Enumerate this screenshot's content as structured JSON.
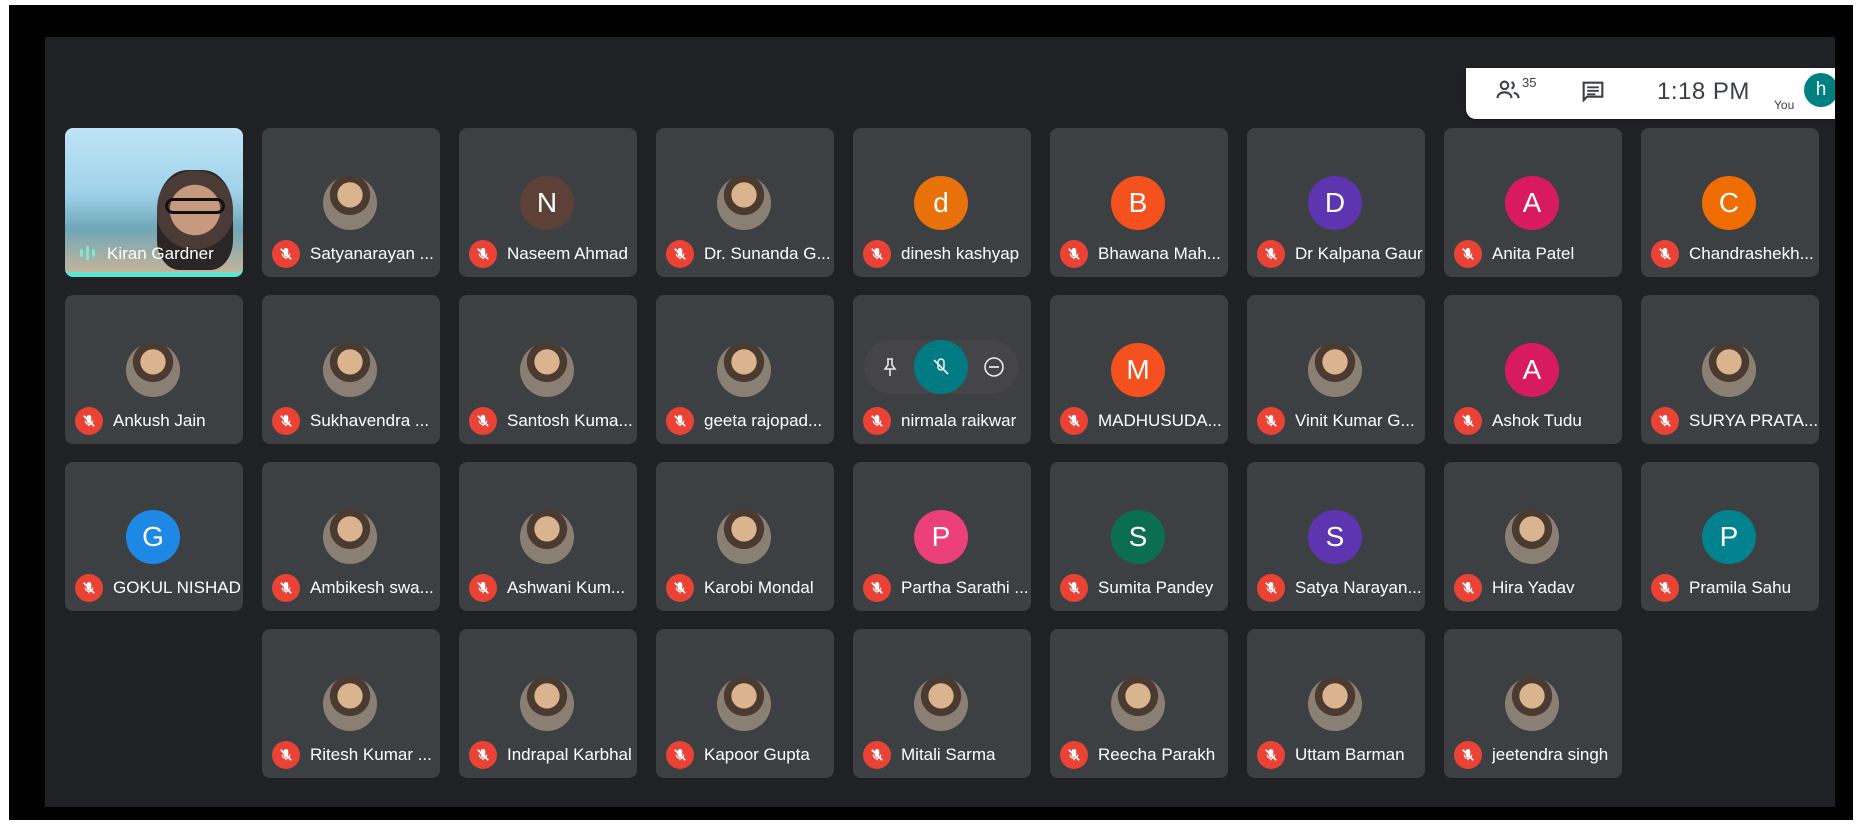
{
  "topbar": {
    "participant_count": "35",
    "time": "1:18 PM",
    "you_label": "You",
    "self_initial": "h",
    "self_color": "#008080"
  },
  "icons": {
    "people": "people-icon",
    "chat": "chat-icon",
    "mic_off": "mic-off-icon",
    "pin": "pin-icon",
    "remove": "remove-icon"
  },
  "participants": [
    {
      "name": "Kiran Gardner",
      "type": "video",
      "featured": true
    },
    {
      "name": "Satyanarayan ...",
      "type": "photo"
    },
    {
      "name": "Naseem Ahmad",
      "initial": "N",
      "color": "#5d4037"
    },
    {
      "name": "Dr. Sunanda G...",
      "type": "photo"
    },
    {
      "name": "dinesh kashyap",
      "initial": "d",
      "color": "#e8710a"
    },
    {
      "name": "Bhawana Mah...",
      "initial": "B",
      "color": "#f4511e"
    },
    {
      "name": "Dr Kalpana Gaur",
      "initial": "D",
      "color": "#5e35b1"
    },
    {
      "name": "Anita Patel",
      "initial": "A",
      "color": "#d81b60"
    },
    {
      "name": "Chandrashekh...",
      "initial": "C",
      "color": "#ef6c00"
    },
    {
      "name": "Ankush Jain",
      "type": "photo"
    },
    {
      "name": "Sukhavendra ...",
      "type": "photo"
    },
    {
      "name": "Santosh Kuma...",
      "type": "photo"
    },
    {
      "name": "geeta rajopad...",
      "type": "photo"
    },
    {
      "name": "nirmala raikwar",
      "type": "hover"
    },
    {
      "name": "MADHUSUDA...",
      "initial": "M",
      "color": "#f4511e"
    },
    {
      "name": "Vinit Kumar G...",
      "type": "photo"
    },
    {
      "name": "Ashok Tudu",
      "initial": "A",
      "color": "#d81b60"
    },
    {
      "name": "SURYA PRATA...",
      "type": "photo"
    },
    {
      "name": "GOKUL NISHAD",
      "initial": "G",
      "color": "#1e88e5"
    },
    {
      "name": "Ambikesh swa...",
      "type": "photo"
    },
    {
      "name": "Ashwani Kum...",
      "type": "photo"
    },
    {
      "name": "Karobi Mondal",
      "type": "photo"
    },
    {
      "name": "Partha Sarathi ...",
      "initial": "P",
      "color": "#ec407a"
    },
    {
      "name": "Sumita Pandey",
      "initial": "S",
      "color": "#0b6e4f"
    },
    {
      "name": "Satya Narayan...",
      "initial": "S",
      "color": "#5e35b1"
    },
    {
      "name": "Hira Yadav",
      "type": "photo"
    },
    {
      "name": "Pramila Sahu",
      "initial": "P",
      "color": "#00838f"
    },
    {
      "name": "Ritesh Kumar ...",
      "type": "photo"
    },
    {
      "name": "Indrapal Karbhal",
      "type": "photo"
    },
    {
      "name": "Kapoor Gupta",
      "type": "photo"
    },
    {
      "name": "Mitali Sarma",
      "type": "photo"
    },
    {
      "name": "Reecha Parakh",
      "type": "photo"
    },
    {
      "name": "Uttam Barman",
      "type": "photo"
    },
    {
      "name": "jeetendra singh",
      "type": "photo"
    }
  ]
}
